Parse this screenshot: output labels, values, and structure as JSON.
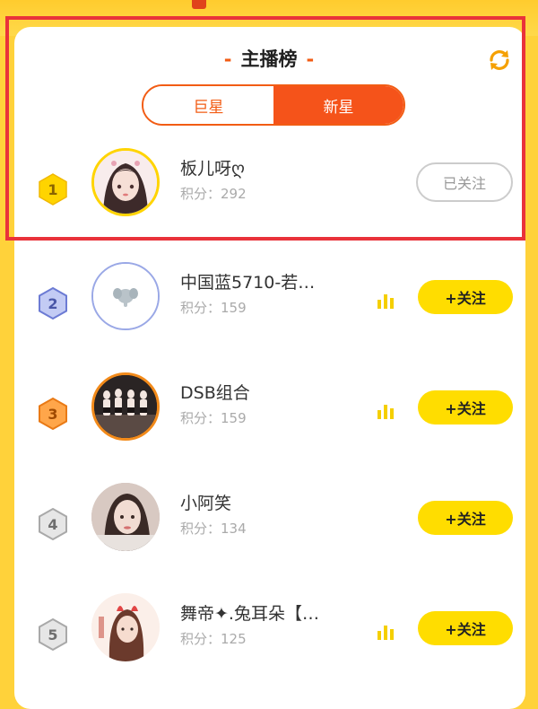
{
  "title": "主播榜",
  "title_dash": "-",
  "tabs": [
    {
      "label": "巨星",
      "active": false
    },
    {
      "label": "新星",
      "active": true
    }
  ],
  "colors": {
    "accent": "#f5531a",
    "follow_button": "#ffdd00",
    "background": "#ffd23a",
    "highlight_box": "#e9323a"
  },
  "icons": {
    "refresh": "refresh-icon",
    "signal": "signal-bars-icon",
    "rank": "rank-badge-icon"
  },
  "anchors": [
    {
      "rank": "1",
      "name": "板儿呀ღ",
      "score": "积分：292",
      "button": "已关注",
      "followed": true,
      "live": false
    },
    {
      "rank": "2",
      "name": "中国蓝5710-若…",
      "score": "积分：159",
      "button": "+关注",
      "followed": false,
      "live": true
    },
    {
      "rank": "3",
      "name": "DSB组合",
      "score": "积分：159",
      "button": "+关注",
      "followed": false,
      "live": true
    },
    {
      "rank": "4",
      "name": "小阿笑",
      "score": "积分：134",
      "button": "+关注",
      "followed": false,
      "live": false
    },
    {
      "rank": "5",
      "name": "舞帝✦.兔耳朵【…",
      "score": "积分：125",
      "button": "+关注",
      "followed": false,
      "live": true
    }
  ]
}
